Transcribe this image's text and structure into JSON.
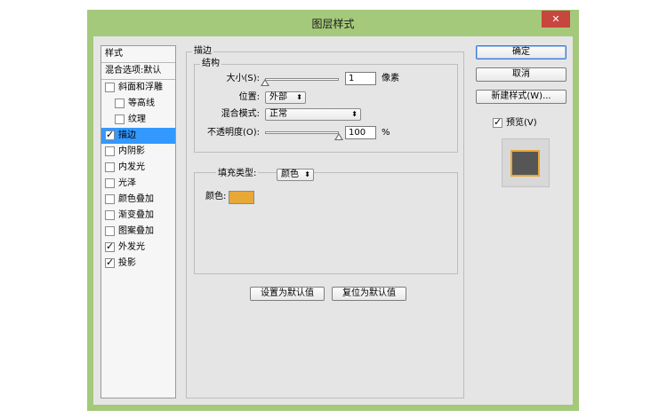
{
  "window": {
    "title": "图层样式",
    "close_glyph": "✕"
  },
  "style_list": {
    "header_styles": "样式",
    "header_blending": "混合选项:默认",
    "items": [
      {
        "label": "斜面和浮雕",
        "checked": false,
        "selected": false,
        "indent": false
      },
      {
        "label": "等高线",
        "checked": false,
        "selected": false,
        "indent": true
      },
      {
        "label": "纹理",
        "checked": false,
        "selected": false,
        "indent": true
      },
      {
        "label": "描边",
        "checked": true,
        "selected": true,
        "indent": false
      },
      {
        "label": "内阴影",
        "checked": false,
        "selected": false,
        "indent": false
      },
      {
        "label": "内发光",
        "checked": false,
        "selected": false,
        "indent": false
      },
      {
        "label": "光泽",
        "checked": false,
        "selected": false,
        "indent": false
      },
      {
        "label": "颜色叠加",
        "checked": false,
        "selected": false,
        "indent": false
      },
      {
        "label": "渐变叠加",
        "checked": false,
        "selected": false,
        "indent": false
      },
      {
        "label": "图案叠加",
        "checked": false,
        "selected": false,
        "indent": false
      },
      {
        "label": "外发光",
        "checked": true,
        "selected": false,
        "indent": false
      },
      {
        "label": "投影",
        "checked": true,
        "selected": false,
        "indent": false
      }
    ],
    "check_glyph": "✓"
  },
  "stroke": {
    "title": "描边",
    "structure": {
      "title": "结构",
      "size_label": "大小(S):",
      "size_value": "1",
      "size_unit": "像素",
      "size_fraction": 0.0,
      "position_label": "位置:",
      "position_value": "外部",
      "blend_label": "混合模式:",
      "blend_value": "正常",
      "opacity_label": "不透明度(O):",
      "opacity_value": "100",
      "opacity_unit": "%",
      "opacity_fraction": 1.0
    },
    "fill": {
      "type_label": "填充类型:",
      "type_value": "颜色",
      "color_label": "颜色:",
      "color_hex": "#e8a838"
    },
    "make_default": "设置为默认值",
    "reset_default": "复位为默认值"
  },
  "actions": {
    "ok": "确定",
    "cancel": "取消",
    "new_style": "新建样式(W)...",
    "preview_label": "预览(V)",
    "preview_checked": true
  },
  "colors": {
    "titlebar": "#a4c97a",
    "selection": "#3399ff",
    "close": "#c7463e",
    "stroke_color": "#e8a838",
    "preview_fill": "#565656"
  },
  "icons": {
    "select_arrow": "⬍",
    "check": "✓"
  }
}
